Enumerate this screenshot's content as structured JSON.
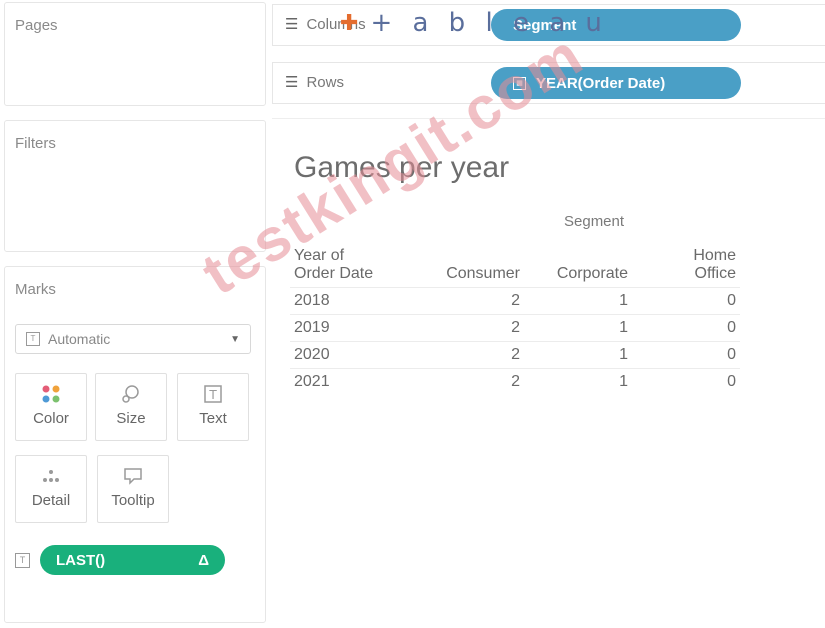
{
  "panels": {
    "pages": {
      "title": "Pages"
    },
    "filters": {
      "title": "Filters"
    },
    "marks": {
      "title": "Marks",
      "mark_type": "Automatic",
      "buttons": [
        {
          "label": "Color",
          "icon": "color-icon"
        },
        {
          "label": "Size",
          "icon": "size-icon"
        },
        {
          "label": "Text",
          "icon": "text-icon"
        },
        {
          "label": "Detail",
          "icon": "detail-icon"
        },
        {
          "label": "Tooltip",
          "icon": "tooltip-icon"
        }
      ],
      "pill": {
        "label": "LAST()",
        "delta": "Δ",
        "color": "#19b07c"
      }
    }
  },
  "shelves": {
    "columns": {
      "label": "Columns",
      "pill": "Segment"
    },
    "rows": {
      "label": "Rows",
      "pill": "YEAR(Order Date)"
    },
    "pill_color": "#4a9fc6"
  },
  "logo": {
    "text": "+ a b l e a u"
  },
  "viz": {
    "title": "Games per year",
    "segment_header": "Segment",
    "row_header_line1": "Year of",
    "row_header_line2": "Order Date",
    "columns": [
      {
        "line1": "",
        "line2": "Consumer"
      },
      {
        "line1": "",
        "line2": "Corporate"
      },
      {
        "line1": "Home",
        "line2": "Office"
      }
    ],
    "rows": [
      {
        "year": "2018",
        "values": [
          "2",
          "1",
          "0"
        ]
      },
      {
        "year": "2019",
        "values": [
          "2",
          "1",
          "0"
        ]
      },
      {
        "year": "2020",
        "values": [
          "2",
          "1",
          "0"
        ]
      },
      {
        "year": "2021",
        "values": [
          "2",
          "1",
          "0"
        ]
      }
    ]
  },
  "watermark": "testkingit.com"
}
